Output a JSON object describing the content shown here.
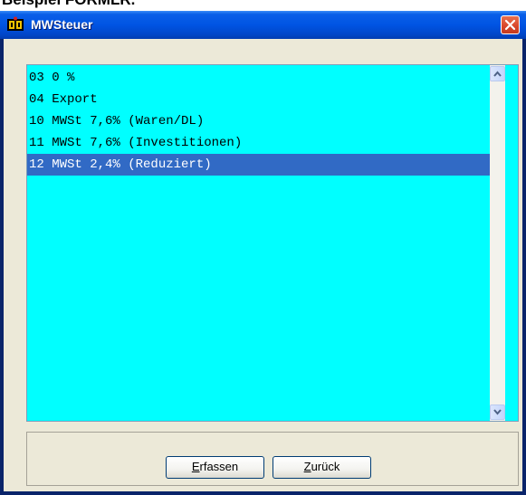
{
  "document": {
    "heading": "Beispiel FORMLR."
  },
  "window": {
    "title": "MWSteuer",
    "icon": "app-emblem-icon",
    "close_icon": "close-icon"
  },
  "list": {
    "items": [
      {
        "label": "03 0 %",
        "selected": false
      },
      {
        "label": "04 Export",
        "selected": false
      },
      {
        "label": "10 MWSt 7,6% (Waren/DL)",
        "selected": false
      },
      {
        "label": "11 MWSt 7,6% (Investitionen)",
        "selected": false
      },
      {
        "label": "12 MWSt 2,4% (Reduziert)",
        "selected": true
      }
    ],
    "background_color": "#00FFFF",
    "selection_color": "#316AC5"
  },
  "buttons": {
    "erfassen": {
      "hotkey": "E",
      "rest": "rfassen"
    },
    "zurueck": {
      "hotkey": "Z",
      "rest": "urück"
    }
  }
}
